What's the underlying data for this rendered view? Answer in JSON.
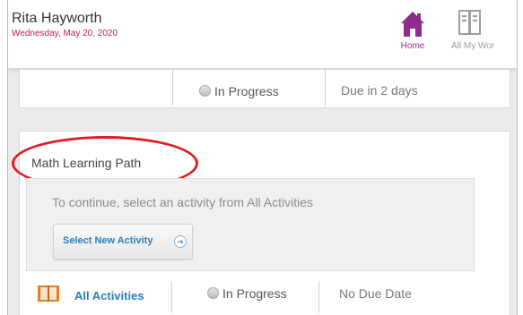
{
  "header": {
    "user_name": "Rita Hayworth",
    "date": "Wednesday, May 20, 2020",
    "nav": {
      "home_label": "Home",
      "all_work_label": "All My Wor"
    }
  },
  "top_card": {
    "status": "In Progress",
    "due": "Due in 2 days"
  },
  "learning_path": {
    "title": "Math Learning Path",
    "instruction": "To continue, select an activity from All Activities",
    "select_button_label": "Select New Activity",
    "row": {
      "link_label": "All Activities",
      "status": "In Progress",
      "due": "No Due Date"
    }
  },
  "colors": {
    "accent_purple": "#8e2c8e",
    "date_pink": "#c2185b",
    "link_blue": "#2a7fb8",
    "highlight_red": "#e01b24"
  },
  "icons": [
    "home-icon",
    "all-work-icon",
    "status-circle-icon",
    "arrow-right-icon",
    "book-icon"
  ]
}
